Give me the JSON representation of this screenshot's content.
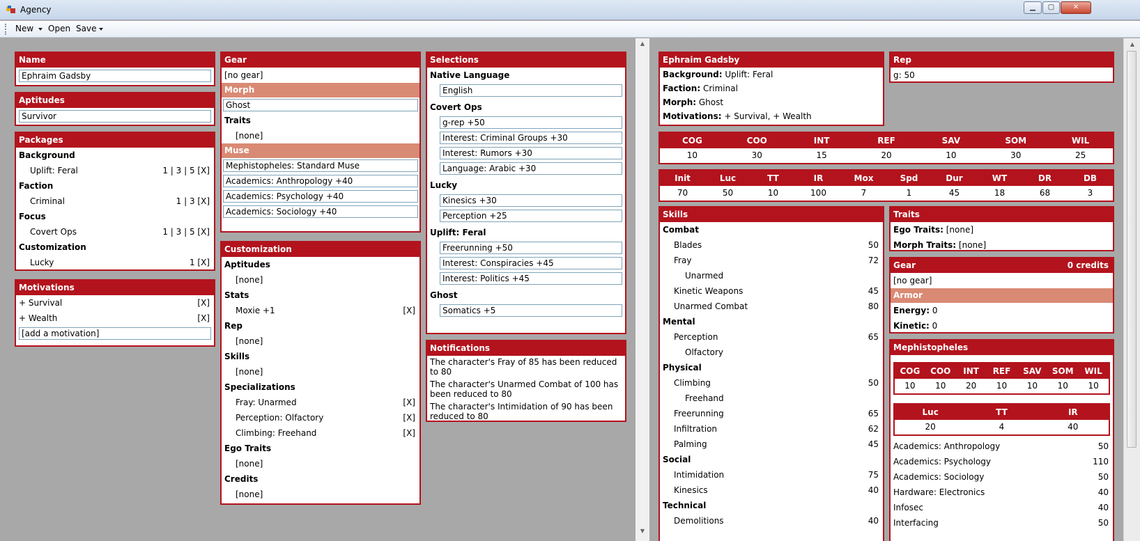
{
  "window": {
    "title": "Agency"
  },
  "toolbar": {
    "new": "New",
    "open": "Open",
    "save": "Save"
  },
  "name_panel": {
    "header": "Name",
    "value": "Ephraim Gadsby"
  },
  "aptitudes_panel": {
    "header": "Aptitudes",
    "value": "Survivor"
  },
  "packages": {
    "header": "Packages",
    "groups": [
      {
        "label": "Background",
        "item": "Uplift: Feral",
        "levels": "1 | 3 | 5 [X]"
      },
      {
        "label": "Faction",
        "item": "Criminal",
        "levels": "1 | 3 [X]"
      },
      {
        "label": "Focus",
        "item": "Covert Ops",
        "levels": "1 | 3 | 5 [X]"
      },
      {
        "label": "Customization",
        "item": "Lucky",
        "levels": "1 [X]"
      }
    ]
  },
  "motivations": {
    "header": "Motivations",
    "items": [
      "+ Survival",
      "+ Wealth"
    ],
    "remove": "[X]",
    "add": "[add a motivation]"
  },
  "gear": {
    "header": "Gear",
    "no_gear": "[no gear]",
    "morph_header": "Morph",
    "morph": "Ghost",
    "traits_label": "Traits",
    "traits_value": "[none]",
    "muse_header": "Muse",
    "muse": "Mephistopheles: Standard Muse",
    "muse_skills": [
      "Academics: Anthropology +40",
      "Academics: Psychology +40",
      "Academics: Sociology +40"
    ]
  },
  "customization": {
    "header": "Customization",
    "sections": [
      {
        "label": "Aptitudes",
        "items": [
          "[none]"
        ]
      },
      {
        "label": "Stats",
        "items": [
          "Moxie +1"
        ]
      },
      {
        "label": "Rep",
        "items": [
          "[none]"
        ]
      },
      {
        "label": "Skills",
        "items": [
          "[none]"
        ]
      },
      {
        "label": "Specializations",
        "items": [
          "Fray: Unarmed",
          "Perception: Olfactory",
          "Climbing: Freehand"
        ]
      },
      {
        "label": "Ego Traits",
        "items": [
          "[none]"
        ]
      },
      {
        "label": "Credits",
        "items": [
          "[none]"
        ]
      }
    ],
    "remove": "[X]"
  },
  "selections": {
    "header": "Selections",
    "groups": [
      {
        "label": "Native Language",
        "items": [
          "English"
        ]
      },
      {
        "label": "Covert Ops",
        "items": [
          "g-rep +50",
          "Interest: Criminal Groups +30",
          "Interest: Rumors +30",
          "Language: Arabic +30"
        ]
      },
      {
        "label": "Lucky",
        "items": [
          "Kinesics +30",
          "Perception +25"
        ]
      },
      {
        "label": "Uplift: Feral",
        "items": [
          "Freerunning +50",
          "Interest: Conspiracies +45",
          "Interest: Politics +45"
        ]
      },
      {
        "label": "Ghost",
        "items": [
          "Somatics +5"
        ]
      }
    ]
  },
  "notifications": {
    "header": "Notifications",
    "items": [
      "The character's Fray of 85 has been reduced to 80",
      "The character's Unarmed Combat of 100 has been reduced to 80",
      "The character's Intimidation of 90 has been reduced to 80"
    ]
  },
  "summary": {
    "header": "Ephraim Gadsby",
    "lines": [
      {
        "k": "Background:",
        "v": " Uplift: Feral"
      },
      {
        "k": "Faction:",
        "v": " Criminal"
      },
      {
        "k": "Morph:",
        "v": " Ghost"
      },
      {
        "k": "Motivations:",
        "v": " + Survival, + Wealth"
      }
    ]
  },
  "rep": {
    "header": "Rep",
    "value": "g: 50"
  },
  "aptitude_stats": {
    "labels": [
      "COG",
      "COO",
      "INT",
      "REF",
      "SAV",
      "SOM",
      "WIL"
    ],
    "values": [
      "10",
      "30",
      "15",
      "20",
      "10",
      "30",
      "25"
    ]
  },
  "derived_stats": {
    "labels": [
      "Init",
      "Luc",
      "TT",
      "IR",
      "Mox",
      "Spd",
      "Dur",
      "WT",
      "DR",
      "DB"
    ],
    "values": [
      "70",
      "50",
      "10",
      "100",
      "7",
      "1",
      "45",
      "18",
      "68",
      "3"
    ]
  },
  "skills": {
    "header": "Skills",
    "rows": [
      {
        "t": "g",
        "l": "Combat"
      },
      {
        "t": "s",
        "l": "Blades",
        "v": "50"
      },
      {
        "t": "s",
        "l": "Fray",
        "v": "72"
      },
      {
        "t": "sp",
        "l": "Unarmed"
      },
      {
        "t": "s",
        "l": "Kinetic Weapons",
        "v": "45"
      },
      {
        "t": "s",
        "l": "Unarmed Combat",
        "v": "80"
      },
      {
        "t": "g",
        "l": "Mental"
      },
      {
        "t": "s",
        "l": "Perception",
        "v": "65"
      },
      {
        "t": "sp",
        "l": "Olfactory"
      },
      {
        "t": "g",
        "l": "Physical"
      },
      {
        "t": "s",
        "l": "Climbing",
        "v": "50"
      },
      {
        "t": "sp",
        "l": "Freehand"
      },
      {
        "t": "s",
        "l": "Freerunning",
        "v": "65"
      },
      {
        "t": "s",
        "l": "Infiltration",
        "v": "62"
      },
      {
        "t": "s",
        "l": "Palming",
        "v": "45"
      },
      {
        "t": "g",
        "l": "Social"
      },
      {
        "t": "s",
        "l": "Intimidation",
        "v": "75"
      },
      {
        "t": "s",
        "l": "Kinesics",
        "v": "40"
      },
      {
        "t": "g",
        "l": "Technical"
      },
      {
        "t": "s",
        "l": "Demolitions",
        "v": "40"
      }
    ]
  },
  "traits": {
    "header": "Traits",
    "ego_label": "Ego Traits:",
    "ego_value": " [none]",
    "morph_label": "Morph Traits:",
    "morph_value": " [none]"
  },
  "gear_summary": {
    "header": "Gear",
    "credits": "0 credits",
    "no_gear": "[no gear]",
    "armor_header": "Armor",
    "energy_label": "Energy:",
    "energy_value": " 0",
    "kinetic_label": "Kinetic:",
    "kinetic_value": " 0"
  },
  "muse": {
    "header": "Mephistopheles",
    "apt_labels": [
      "COG",
      "COO",
      "INT",
      "REF",
      "SAV",
      "SOM",
      "WIL"
    ],
    "apt_values": [
      "10",
      "10",
      "20",
      "10",
      "10",
      "10",
      "10"
    ],
    "der_labels": [
      "Luc",
      "TT",
      "IR"
    ],
    "der_values": [
      "20",
      "4",
      "40"
    ],
    "skills": [
      {
        "l": "Academics: Anthropology",
        "v": "50"
      },
      {
        "l": "Academics: Psychology",
        "v": "110"
      },
      {
        "l": "Academics: Sociology",
        "v": "50"
      },
      {
        "l": "Hardware: Electronics",
        "v": "40"
      },
      {
        "l": "Infosec",
        "v": "40"
      },
      {
        "l": "Interfacing",
        "v": "50"
      }
    ]
  },
  "colors": {
    "accent": "#b3131d",
    "subheader": "#d98a74",
    "background": "#a8a8a8"
  },
  "icons": [
    "app-icon",
    "minimize-icon",
    "maximize-icon",
    "close-icon",
    "dropdown-arrow-icon",
    "scroll-up-icon",
    "scroll-down-icon"
  ]
}
